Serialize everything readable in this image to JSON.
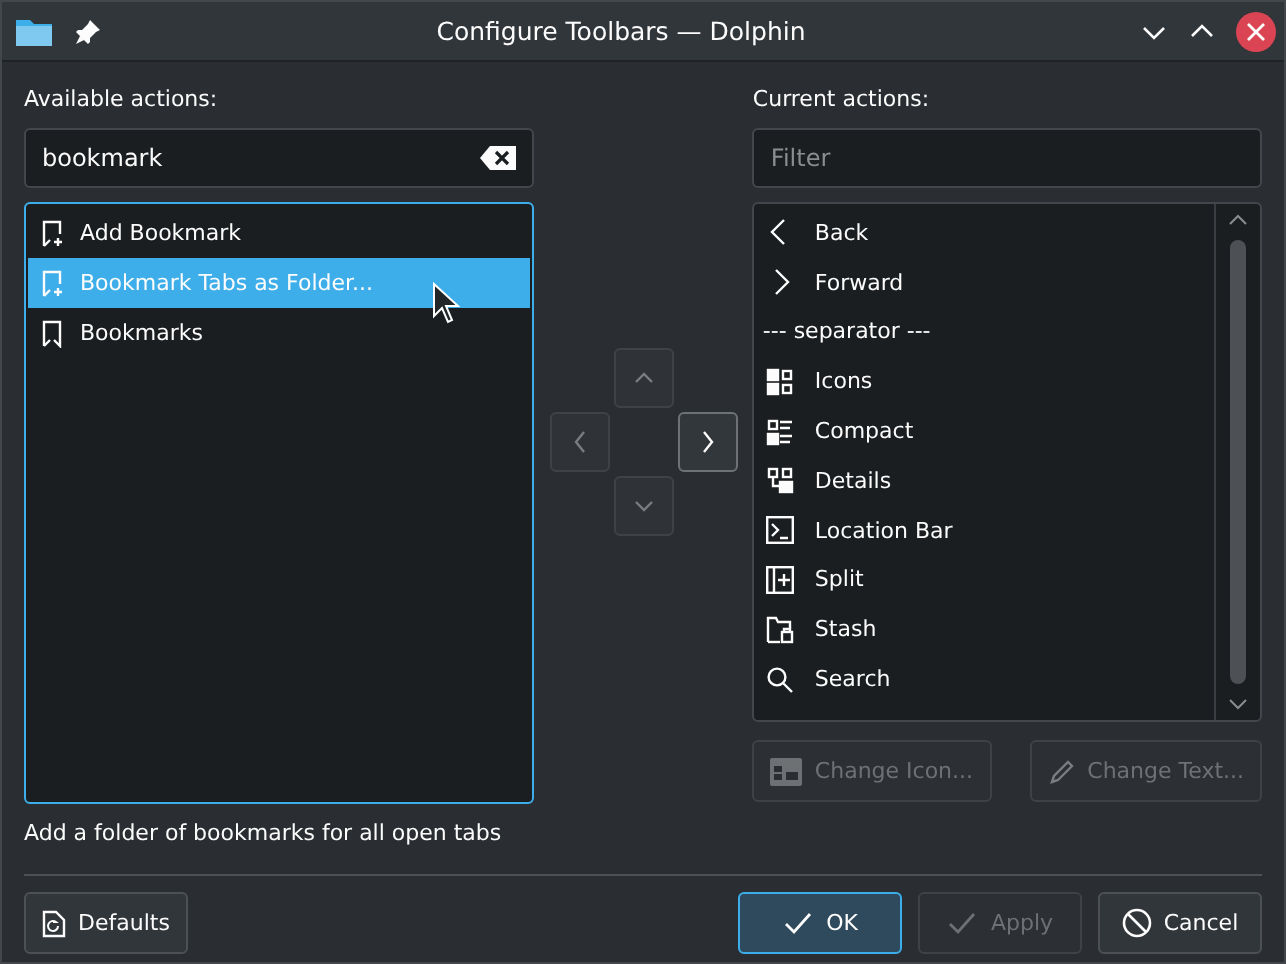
{
  "window": {
    "title": "Configure Toolbars — Dolphin"
  },
  "available": {
    "label": "Available actions:",
    "search": {
      "value": "bookmark"
    },
    "items": [
      {
        "label": "Add Bookmark",
        "selected": false
      },
      {
        "label": "Bookmark Tabs as Folder...",
        "selected": true
      },
      {
        "label": "Bookmarks",
        "selected": false
      }
    ],
    "description": "Add a folder of bookmarks for all open tabs"
  },
  "move_buttons": [
    {
      "disabled": true
    },
    {
      "disabled": true
    },
    {
      "disabled": false
    },
    {
      "disabled": true
    }
  ],
  "current": {
    "label": "Current actions:",
    "filter": {
      "placeholder": "Filter"
    },
    "items": [
      {
        "kind": "action",
        "label": "Back"
      },
      {
        "kind": "action",
        "label": "Forward"
      },
      {
        "kind": "separator",
        "label": "--- separator ---"
      },
      {
        "kind": "action",
        "label": "Icons"
      },
      {
        "kind": "action",
        "label": "Compact"
      },
      {
        "kind": "action",
        "label": "Details"
      },
      {
        "kind": "action",
        "label": "Location Bar"
      },
      {
        "kind": "action",
        "label": "Split"
      },
      {
        "kind": "action",
        "label": "Stash"
      },
      {
        "kind": "action",
        "label": "Search"
      }
    ],
    "buttons": [
      {
        "label": "Change Icon...",
        "disabled": true
      },
      {
        "label": "Change Text...",
        "disabled": true
      }
    ]
  },
  "footer": {
    "left": {
      "label": "Defaults",
      "disabled": false
    },
    "buttons": [
      {
        "label": "OK",
        "default": true,
        "disabled": false
      },
      {
        "label": "Apply",
        "default": false,
        "disabled": true
      },
      {
        "label": "Cancel",
        "default": false,
        "disabled": false
      }
    ]
  }
}
